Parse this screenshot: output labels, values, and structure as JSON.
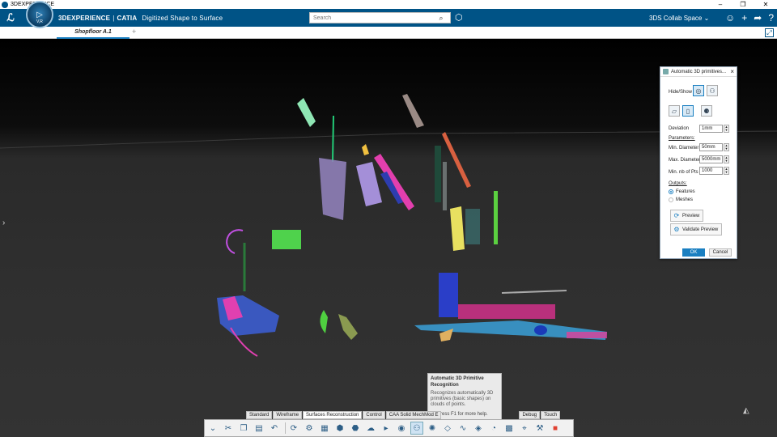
{
  "os_bar": {
    "title": "3DEXPERIENCE",
    "min_icon": "minimize-icon",
    "max_icon": "maximize-icon",
    "close_icon": "close-icon"
  },
  "header": {
    "logo_icon": "ds-logo-icon",
    "compass_label": "V,R",
    "brand_main": "3DEXPERIENCE",
    "brand_app": "CATIA",
    "brand_role": "Digitized Shape to Surface",
    "search_placeholder": "Search",
    "collab_space": "3DS Collab Space",
    "colors": {
      "header_bg": "#005386",
      "accent": "#1a7fc1"
    }
  },
  "tabs": [
    {
      "label": "Shopfloor A.1"
    }
  ],
  "dialog": {
    "title": "Automatic 3D primitives...",
    "hide_show_label": "Hide/Show",
    "deviation_label": "Deviation",
    "deviation_value": "1mm",
    "parameters_label": "Parameters:",
    "min_diameter_label": "Min. Diameter",
    "min_diameter_value": "50mm",
    "max_diameter_label": "Max. Diameter",
    "max_diameter_value": "5000mm",
    "min_pts_label": "Min. nb of Pts",
    "min_pts_value": "1000",
    "outputs_label": "Outputs:",
    "features_label": "Features",
    "meshes_label": "Meshes",
    "preview_label": "Preview",
    "validate_preview_label": "Validate Preview",
    "ok_label": "OK",
    "cancel_label": "Cancel"
  },
  "tooltip": {
    "title": "Automatic 3D Primitive Recognition",
    "body": "Recognizes automatically 3D primitives (basic shapes) on clouds of points.",
    "help": "Press F1 for more help."
  },
  "sections": [
    {
      "label": "Standard"
    },
    {
      "label": "Wireframe"
    },
    {
      "label": "Surfaces Reconstruction"
    },
    {
      "label": "Control"
    },
    {
      "label": "CAA Solid MechMod E"
    },
    {
      "label": "Debug"
    },
    {
      "label": "Touch"
    }
  ]
}
